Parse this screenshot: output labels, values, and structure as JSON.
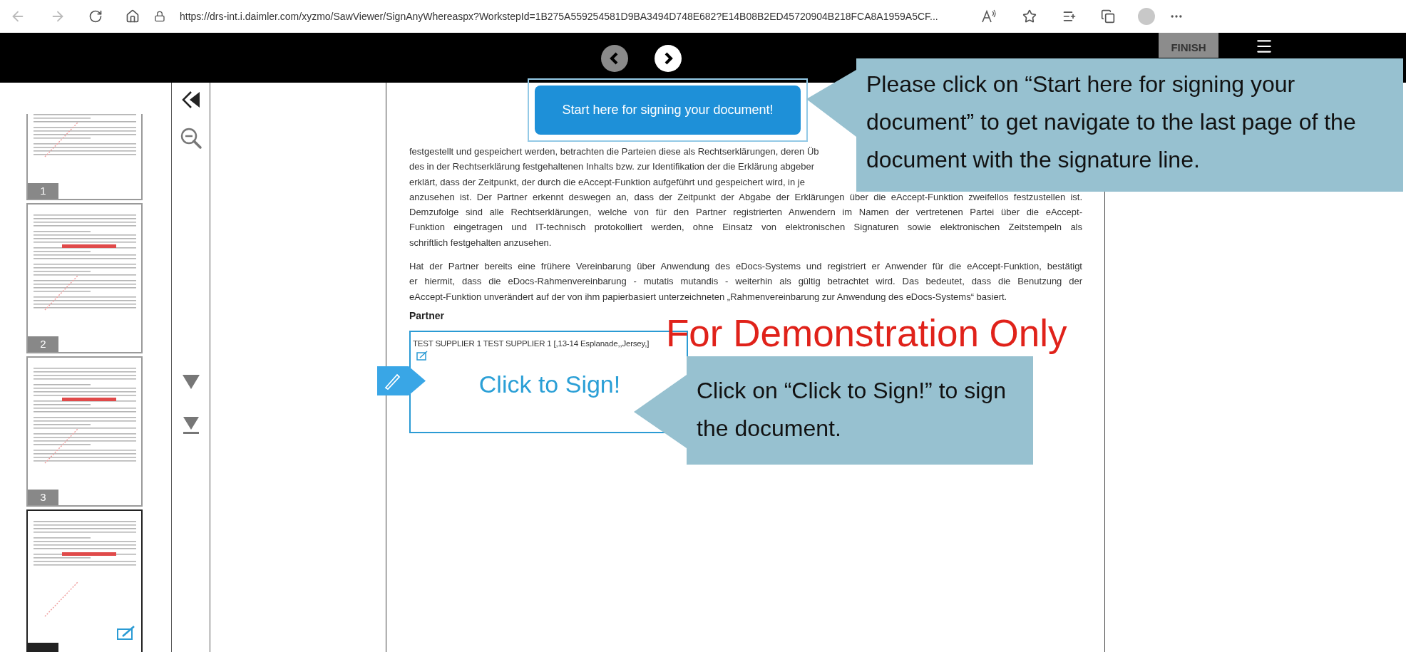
{
  "browser": {
    "url": "https://drs-int.i.daimler.com/xyzmo/SawViewer/SignAnyWhereaspx?WorkstepId=1B275A559254581D9BA3494D748E682?E14B08B2ED45720904B218FCA8A1959A5CF..."
  },
  "toolbar": {
    "finish_label": "FINISH"
  },
  "start_button": {
    "label": "Start here for signing your document!"
  },
  "thumbnails": [
    {
      "number": "1",
      "selected": false,
      "signature_field": false
    },
    {
      "number": "2",
      "selected": false,
      "signature_field": false
    },
    {
      "number": "3",
      "selected": false,
      "signature_field": false
    },
    {
      "selected": true,
      "signature_field": true
    }
  ],
  "document": {
    "paragraphs": [
      {
        "cut_lines": [
          "festgestellt und gespeichert werden, betrachten die Parteien diese als Rechtserklärungen, deren Üb",
          "des in der Rechtserklärung festgehaltenen Inhalts bzw. zur Identifikation der die Erklärung abgeber",
          "erklärt, dass der Zeitpunkt, der durch die eAccept-Funktion aufgeführt und gespeichert wird, in je"
        ],
        "lines": [
          "anzusehen ist. Der Partner erkennt deswegen an, dass der Zeitpunkt der Abgabe der Erklärungen über die eAccept-Funktion zweifellos festzustellen ist.",
          "Demzufolge sind alle Rechtserklärungen, welche von für den Partner registrierten Anwendern im Namen der vertretenen Partei über die eAccept-",
          "Funktion eingetragen und IT-technisch protokolliert werden, ohne Einsatz von elektronischen Signaturen sowie elektronischen Zeitstempeln als",
          "schriftlich festgehalten anzusehen."
        ]
      },
      {
        "lines": [
          "Hat der Partner bereits eine frühere Vereinbarung über Anwendung des eDocs-Systems und registriert er Anwender für die eAccept-Funktion, bestätigt",
          "er hiermit, dass die eDocs-Rahmenvereinbarung - mutatis mutandis - weiterhin als gültig betrachtet wird. Das bedeutet, dass die Benutzung der",
          "eAccept-Funktion unverändert auf der von ihm papierbasiert unterzeichneten „Rahmenvereinbarung zur Anwendung des eDocs-Systems“ basiert."
        ]
      }
    ],
    "heading": "Partner",
    "signature_field": {
      "party": "TEST SUPPLIER 1 TEST SUPPLIER 1 [,13-14 Esplanade,,Jersey,]",
      "action": "Click to Sign!"
    },
    "stamp": "For Demonstration Only"
  },
  "callouts": [
    {
      "text": "Please click on “Start here for signing your document” to get navigate to the last page of the document with the signature line."
    },
    {
      "text": "Click on “Click to Sign!” to sign the document."
    }
  ]
}
